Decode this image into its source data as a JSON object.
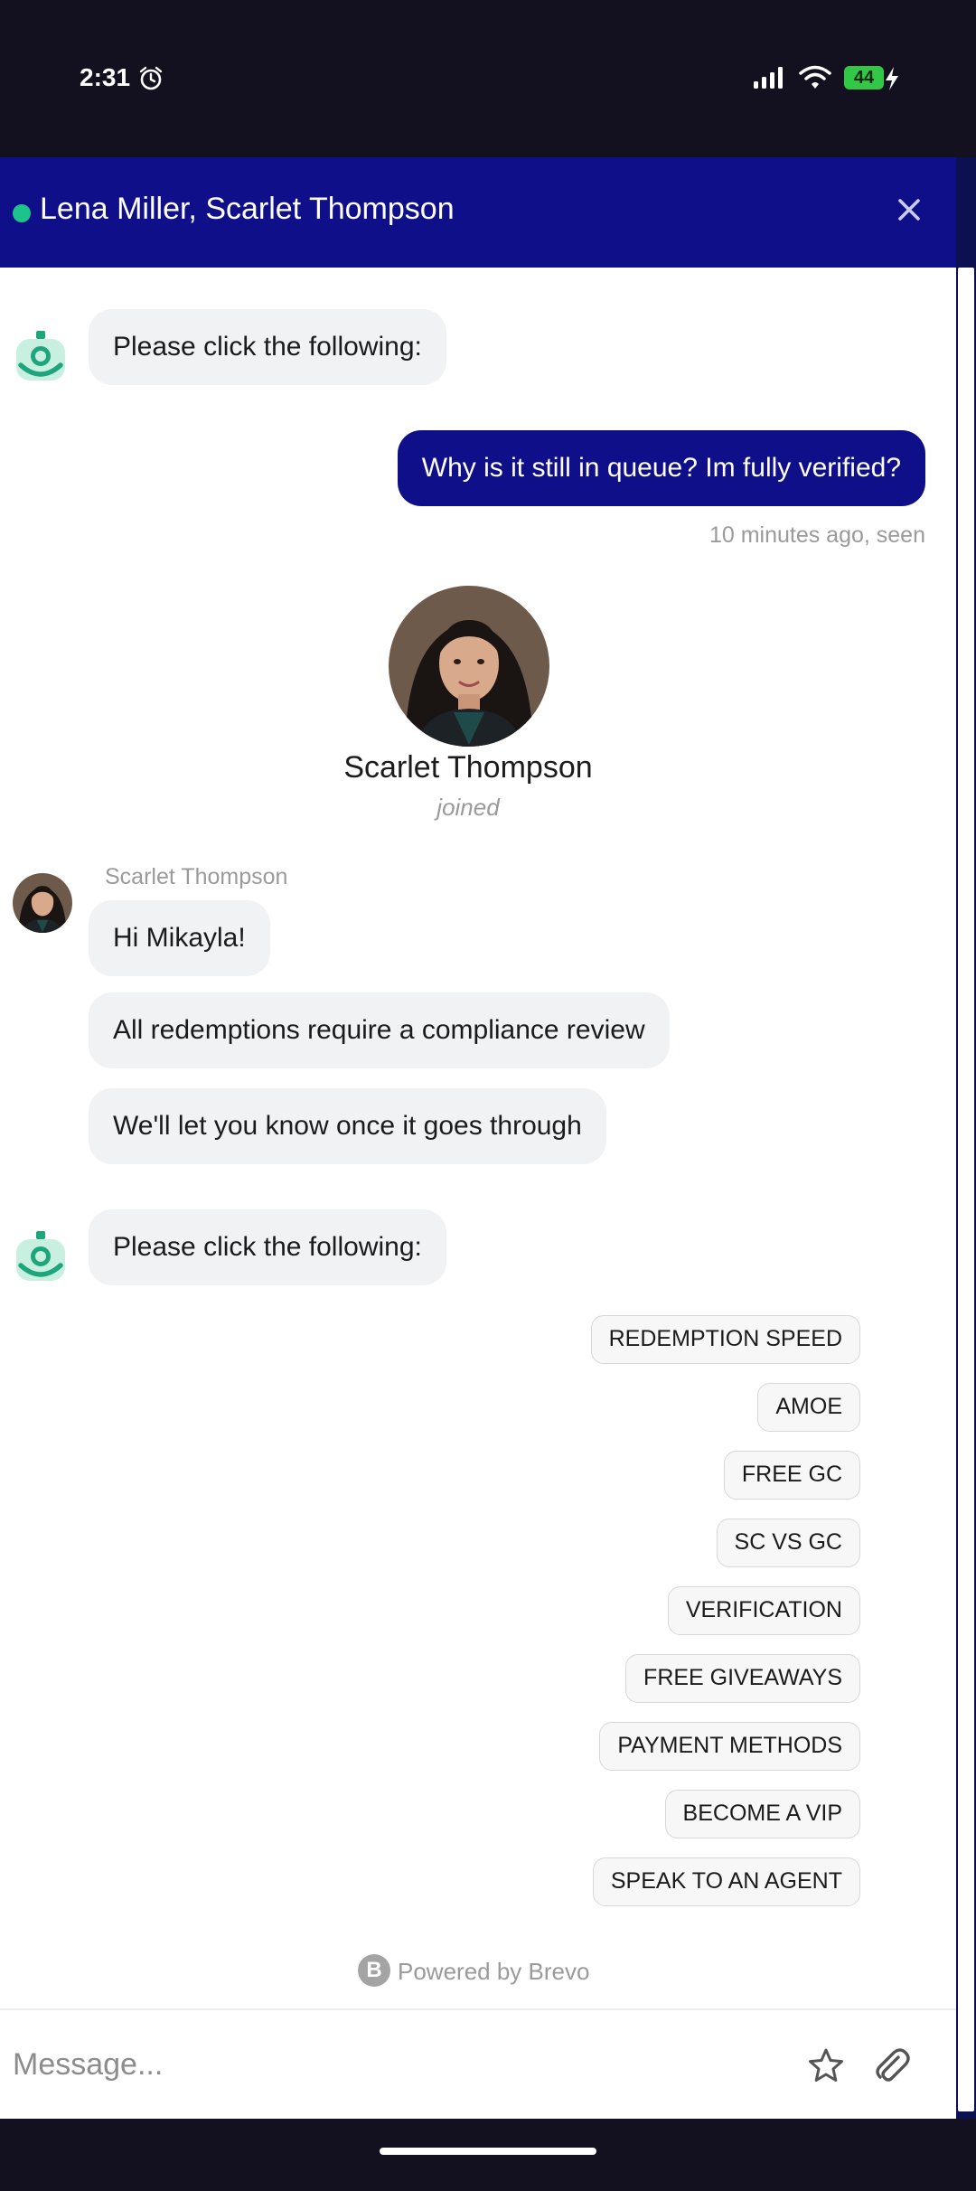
{
  "status_bar": {
    "time": "2:31",
    "battery": "44"
  },
  "header": {
    "title": "Lena Miller, Scarlet Thompson"
  },
  "messages": {
    "bot_prompt_1": "Please click the following:",
    "user_message": "Why is it still in queue? Im fully verified?",
    "user_meta": "10 minutes ago, seen",
    "agent_joined_name": "Scarlet Thompson",
    "agent_joined_label": "joined",
    "agent_sender": "Scarlet Thompson",
    "agent_msg_1": "Hi Mikayla!",
    "agent_msg_2": "All redemptions require a compliance review",
    "agent_msg_3": "We'll let you know once it goes through",
    "bot_prompt_2": "Please click the following:"
  },
  "quick_replies": [
    "REDEMPTION SPEED",
    "AMOE",
    "FREE GC",
    "SC VS GC",
    "VERIFICATION",
    "FREE GIVEAWAYS",
    "PAYMENT METHODS",
    "BECOME A VIP",
    "SPEAK TO AN AGENT"
  ],
  "footer": {
    "badge": "B",
    "powered_by": "Powered by Brevo"
  },
  "composer": {
    "placeholder": "Message..."
  },
  "colors": {
    "brand": "#0f0f8a",
    "online": "#1ec28b",
    "bot": "#1ea57c",
    "bubble": "#f1f2f4"
  },
  "icons": [
    "alarm-icon",
    "signal-icon",
    "wifi-icon",
    "bolt-icon",
    "close-icon",
    "bot-icon",
    "star-icon",
    "attach-icon"
  ]
}
